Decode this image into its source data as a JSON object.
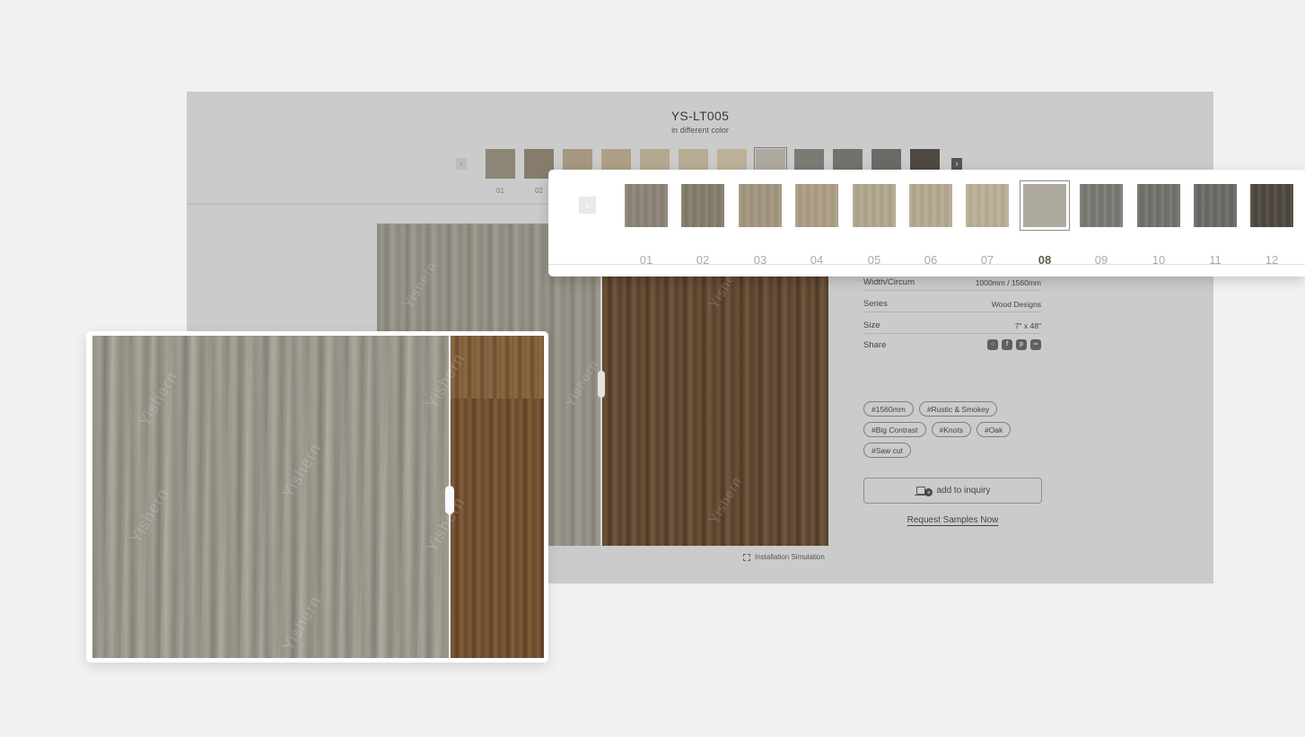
{
  "product": {
    "code": "YS-LT005",
    "subtitle": "in different color"
  },
  "colors": [
    {
      "num": "01",
      "hex": "#8d8576"
    },
    {
      "num": "02",
      "hex": "#857c6c"
    },
    {
      "num": "03",
      "hex": "#a59780"
    },
    {
      "num": "04",
      "hex": "#ad9f85"
    },
    {
      "num": "05",
      "hex": "#b3a88f"
    },
    {
      "num": "06",
      "hex": "#b7ab92"
    },
    {
      "num": "07",
      "hex": "#bcb098"
    },
    {
      "num": "08",
      "hex": "#aea99f"
    },
    {
      "num": "09",
      "hex": "#7b7b74"
    },
    {
      "num": "10",
      "hex": "#72716b"
    },
    {
      "num": "11",
      "hex": "#6b6a65"
    },
    {
      "num": "12",
      "hex": "#4e4840"
    }
  ],
  "selected_color": "08",
  "specs": [
    {
      "label": "Width/Circum",
      "value": "1000mm / 1560mm"
    },
    {
      "label": "Series",
      "value": "Wood Designs"
    },
    {
      "label": "Size",
      "value": "7\" x 48\""
    }
  ],
  "share": {
    "label": "Share",
    "icons": [
      "line-icon",
      "facebook-icon",
      "pinterest-icon",
      "link-icon"
    ]
  },
  "tags": [
    "#1560mm",
    "#Rustic & Smokey",
    "#Big Contrast",
    "#Knots",
    "#Oak",
    "#Saw cut"
  ],
  "actions": {
    "inquiry": "add to inquiry",
    "samples": "Request Samples Now",
    "installation": "Installation Simulation"
  },
  "watermark": "Yishern"
}
